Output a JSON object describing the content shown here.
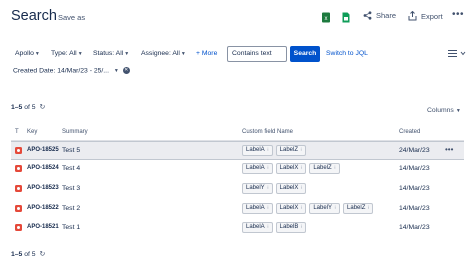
{
  "header": {
    "title": "Search",
    "save_as": "Save as",
    "share": "Share",
    "export": "Export",
    "more": "•••"
  },
  "filters": {
    "project": "Apollo",
    "type": "Type: All",
    "status": "Status: All",
    "assignee": "Assignee: All",
    "more": "+ More",
    "text_value": "Contains text",
    "search": "Search",
    "switch_jql": "Switch to JQL",
    "created_date": "Created Date: 14/Mar/23 - 25/..."
  },
  "results": {
    "count_range": "1–5",
    "count_of": "of 5",
    "columns_label": "Columns",
    "headers": {
      "type": "T",
      "key": "Key",
      "summary": "Summary",
      "custom_field": "Custom field Name",
      "created": "Created"
    },
    "rows": [
      {
        "key": "APO-18525",
        "summary": "Test 5",
        "labels": [
          "LabelA",
          "LabelZ"
        ],
        "created": "24/Mar/23"
      },
      {
        "key": "APO-18524",
        "summary": "Test 4",
        "labels": [
          "LabelA",
          "LabelX",
          "LabelZ"
        ],
        "created": "14/Mar/23"
      },
      {
        "key": "APO-18523",
        "summary": "Test 3",
        "labels": [
          "LabelY",
          "LabelX"
        ],
        "created": "14/Mar/23"
      },
      {
        "key": "APO-18522",
        "summary": "Test 2",
        "labels": [
          "LabelA",
          "LabelX",
          "LabelY",
          "LabelZ"
        ],
        "created": "14/Mar/23"
      },
      {
        "key": "APO-18521",
        "summary": "Test 1",
        "labels": [
          "LabelA",
          "LabelB"
        ],
        "created": "14/Mar/23"
      }
    ]
  },
  "colors": {
    "primary": "#0052cc",
    "bug": "#e5493a",
    "selected_row": "#ebecf0"
  }
}
